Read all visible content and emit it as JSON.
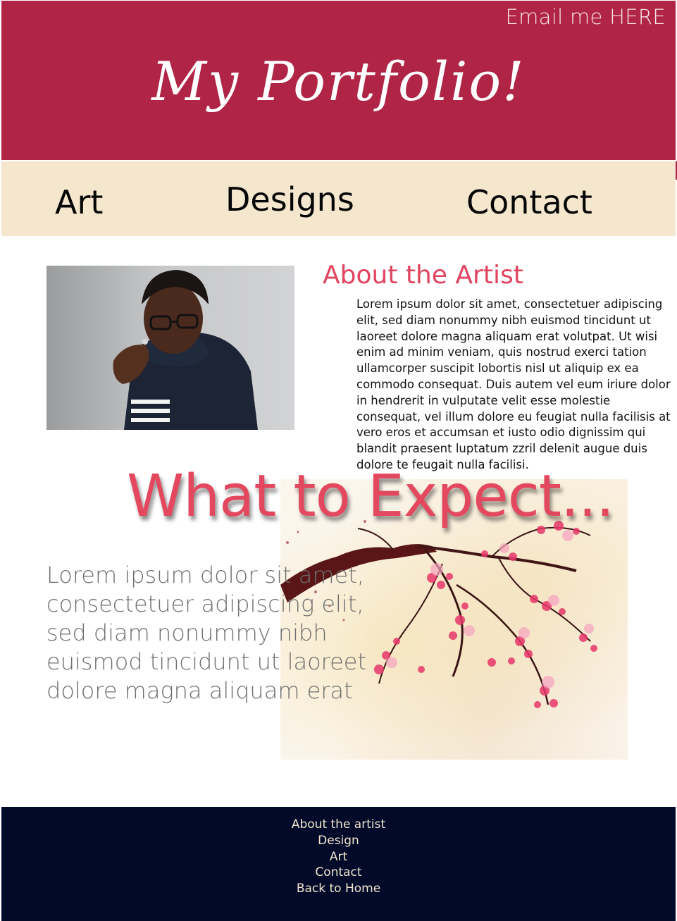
{
  "header": {
    "email_link": "Email me HERE",
    "site_title": "My Portfolio!"
  },
  "nav": {
    "items": [
      {
        "label": "Art"
      },
      {
        "label": "Designs"
      },
      {
        "label": "Contact"
      }
    ]
  },
  "about": {
    "heading": "About the Artist",
    "text": "Lorem ipsum dolor sit amet, consectetuer adipiscing elit, sed diam nonummy nibh euismod tincidunt ut laoreet dolore magna aliquam erat volutpat. Ut wisi enim ad minim veniam, quis nostrud exerci tation ullamcorper suscipit lobortis nisl ut aliquip ex ea commodo consequat. Duis autem vel eum iriure dolor in hendrerit in vulputate velit esse molestie consequat, vel illum dolore eu feugiat nulla facilisis at vero eros et accumsan et iusto odio dignissim qui blandit praesent luptatum zzril delenit augue duis dolore te feugait nulla facilisi."
  },
  "expect": {
    "heading": "What to Expect...",
    "text": "Lorem ipsum dolor sit amet, consectetuer adipiscing elit, sed diam nonummy nibh euismod tincidunt ut laoreet dolore magna aliquam erat"
  },
  "footer": {
    "links": [
      {
        "label": "About the artist"
      },
      {
        "label": "Design"
      },
      {
        "label": "Art"
      },
      {
        "label": "Contact"
      },
      {
        "label": "Back to Home"
      }
    ]
  },
  "colors": {
    "header_bg": "#b02446",
    "nav_bg": "#f5e6ce",
    "accent": "#e0445f",
    "footer_bg": "#020a2a"
  }
}
